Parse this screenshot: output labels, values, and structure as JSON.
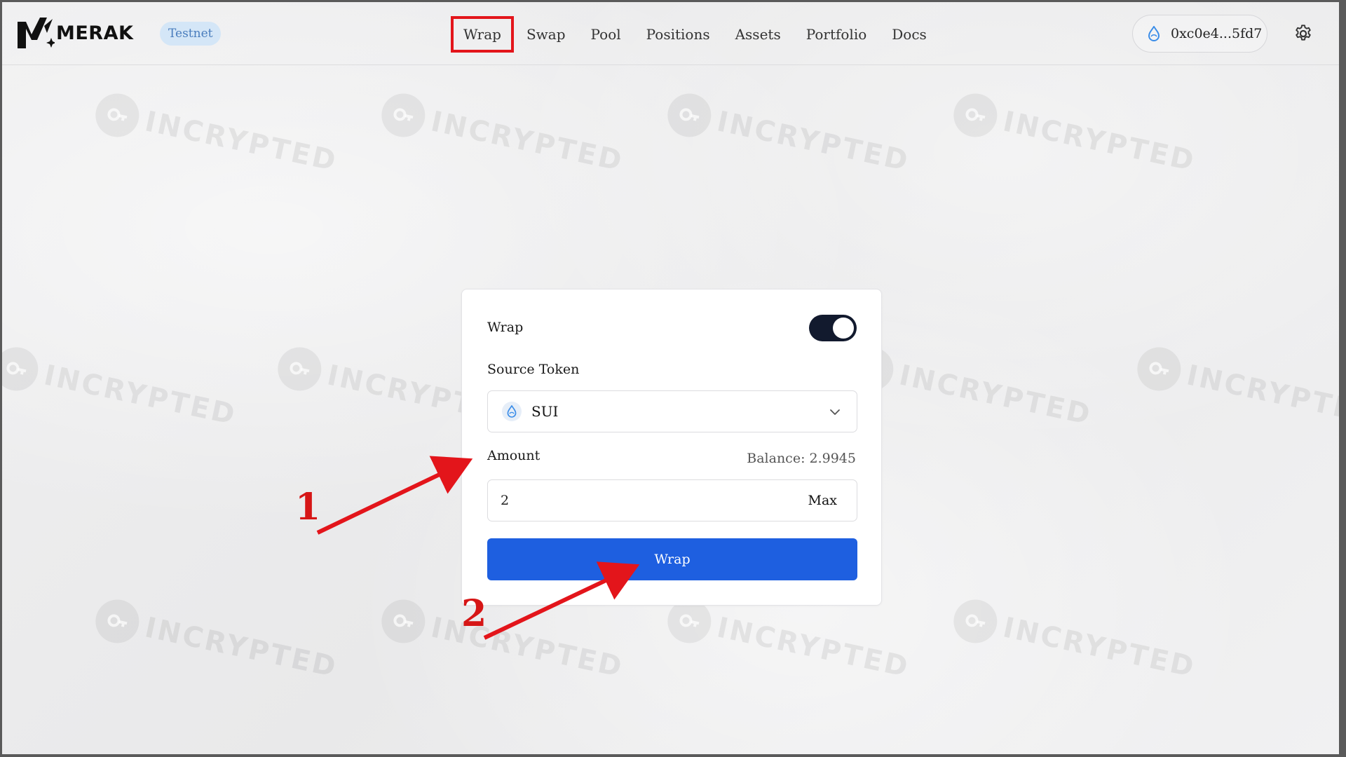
{
  "header": {
    "logo_text": "MERAK",
    "network_badge": "Testnet",
    "nav": [
      {
        "label": "Wrap",
        "active": true
      },
      {
        "label": "Swap",
        "active": false
      },
      {
        "label": "Pool",
        "active": false
      },
      {
        "label": "Positions",
        "active": false
      },
      {
        "label": "Assets",
        "active": false
      },
      {
        "label": "Portfolio",
        "active": false
      },
      {
        "label": "Docs",
        "active": false
      }
    ],
    "wallet_address": "0xc0e4...5fd7",
    "wallet_icon": "sui-droplet-icon",
    "settings_icon": "gear-icon"
  },
  "card": {
    "mode_label": "Wrap",
    "toggle_on": true,
    "source_token_label": "Source Token",
    "source_token_value": "SUI",
    "source_token_icon": "sui-droplet-icon",
    "amount_label": "Amount",
    "balance_text": "Balance: 2.9945",
    "amount_value": "2",
    "max_label": "Max",
    "submit_label": "Wrap"
  },
  "watermark_text": "INCRYPTED",
  "annotations": {
    "step1": "1",
    "step2": "2"
  },
  "colors": {
    "accent": "#1e5fe0",
    "toggle": "#121a2e",
    "badge_bg": "#d4e6f7",
    "annotation": "#e3151b"
  }
}
